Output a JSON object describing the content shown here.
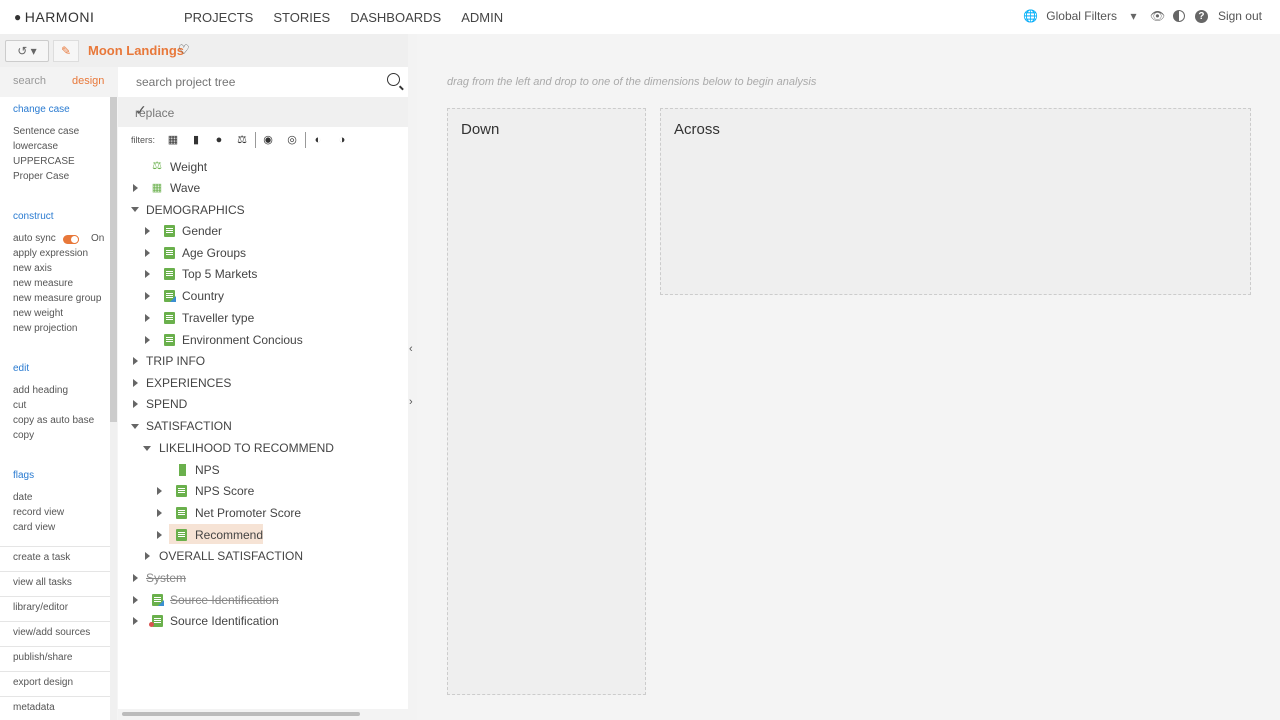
{
  "app": {
    "brand": "HARMONI"
  },
  "nav": {
    "items": [
      "PROJECTS",
      "STORIES",
      "DASHBOARDS",
      "ADMIN"
    ],
    "active": "PROJECTS"
  },
  "topright": {
    "global_filters": "Global Filters",
    "signout": "Sign out"
  },
  "project": {
    "name": "Moon Landings"
  },
  "sidebar": {
    "tabs": [
      "search",
      "design"
    ],
    "active_tab": "design",
    "sections": {
      "change_case": {
        "heading": "change case",
        "items": [
          "Sentence case",
          "lowercase",
          "UPPERCASE",
          "Proper Case"
        ]
      },
      "construct": {
        "heading": "construct",
        "auto_sync": "auto sync",
        "auto_sync_state": "On",
        "items": [
          "apply expression",
          "new axis",
          "new measure",
          "new measure group",
          "new weight",
          "new projection"
        ]
      },
      "edit": {
        "heading": "edit",
        "items": [
          "add heading",
          "cut",
          "copy as auto base",
          "copy"
        ]
      },
      "flags": {
        "heading": "flags",
        "items": [
          "date",
          "record view",
          "card view"
        ]
      }
    },
    "bottom_links": [
      "create a task",
      "view all tasks",
      "library/editor",
      "view/add sources",
      "publish/share",
      "export design",
      "metadata"
    ]
  },
  "tree_panel": {
    "search_placeholder": "search project tree",
    "replace_placeholder": "replace",
    "filters_label": "filters:"
  },
  "tree": {
    "nodes": [
      {
        "label": "Weight"
      },
      {
        "label": "Wave"
      },
      {
        "label": "DEMOGRAPHICS"
      },
      {
        "label": "Gender"
      },
      {
        "label": "Age Groups"
      },
      {
        "label": "Top 5 Markets"
      },
      {
        "label": "Country"
      },
      {
        "label": "Traveller type"
      },
      {
        "label": "Environment Concious"
      },
      {
        "label": "TRIP INFO"
      },
      {
        "label": "EXPERIENCES"
      },
      {
        "label": "SPEND"
      },
      {
        "label": "SATISFACTION"
      },
      {
        "label": "LIKELIHOOD TO RECOMMEND"
      },
      {
        "label": "NPS"
      },
      {
        "label": "NPS Score"
      },
      {
        "label": "Net Promoter Score"
      },
      {
        "label": "Recommend",
        "selected": true
      },
      {
        "label": "OVERALL SATISFACTION"
      },
      {
        "label": "System",
        "strike": true
      },
      {
        "label": "Source Identification",
        "strike": true
      },
      {
        "label": "Source Identification"
      }
    ]
  },
  "analysis": {
    "hint": "drag from the left and drop to one of the dimensions below to begin analysis",
    "down": "Down",
    "across": "Across"
  },
  "colors": {
    "accent": "#e8783a",
    "link": "#2a7bd1",
    "node_icon": "#6ab04c",
    "selected_bg": "#f6e3d5"
  }
}
